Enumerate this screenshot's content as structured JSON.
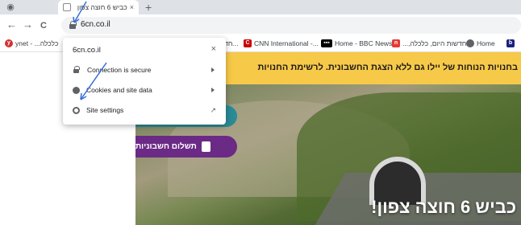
{
  "browser": {
    "tab": {
      "title": "כביש 6 חוצה צפון",
      "close": "×"
    },
    "new_tab": "+",
    "nav": {
      "back": "←",
      "forward": "→",
      "reload": "C"
    },
    "url": "6cn.co.il"
  },
  "bookmarks": [
    {
      "label": "ynet - ...כלכלה",
      "icon": "ynet-icon",
      "color": "#d32f2f"
    },
    {
      "label": "חדש...",
      "icon": "folder-icon",
      "color": "#9e9e9e"
    },
    {
      "label": "CNN International -...",
      "icon": "cnn-icon",
      "color": "#cc0000"
    },
    {
      "label": "Home - BBC News",
      "icon": "bbc-icon",
      "color": "#000000"
    },
    {
      "label": "חדשות היום, כלכלה,...",
      "icon": "news-icon",
      "color": "#e53935"
    },
    {
      "label": "Home",
      "icon": "globe-icon",
      "color": "#5f6368"
    },
    {
      "label": "...",
      "icon": "bookmark-icon",
      "color": "#1a237e"
    }
  ],
  "popup": {
    "host": "6cn.co.il",
    "close": "×",
    "items": [
      {
        "label": "Connection is secure",
        "icon": "lock-icon"
      },
      {
        "label": "Cookies and site data",
        "icon": "cookie-icon"
      },
      {
        "label": "Site settings",
        "icon": "gear-icon"
      }
    ]
  },
  "page": {
    "banner_text": "בחנויות הנוחות של יילו גם ללא הצגת החשבונית.   לרשימת החנויות",
    "pay_button": "תשלום חשבוניות",
    "hero_title": "כביש 6 חוצה צפון!"
  },
  "colors": {
    "banner": "#f7c948",
    "pay_button": "#6b2a86",
    "teal_button": "#2a8a96",
    "annotation": "#3a6fd8"
  }
}
